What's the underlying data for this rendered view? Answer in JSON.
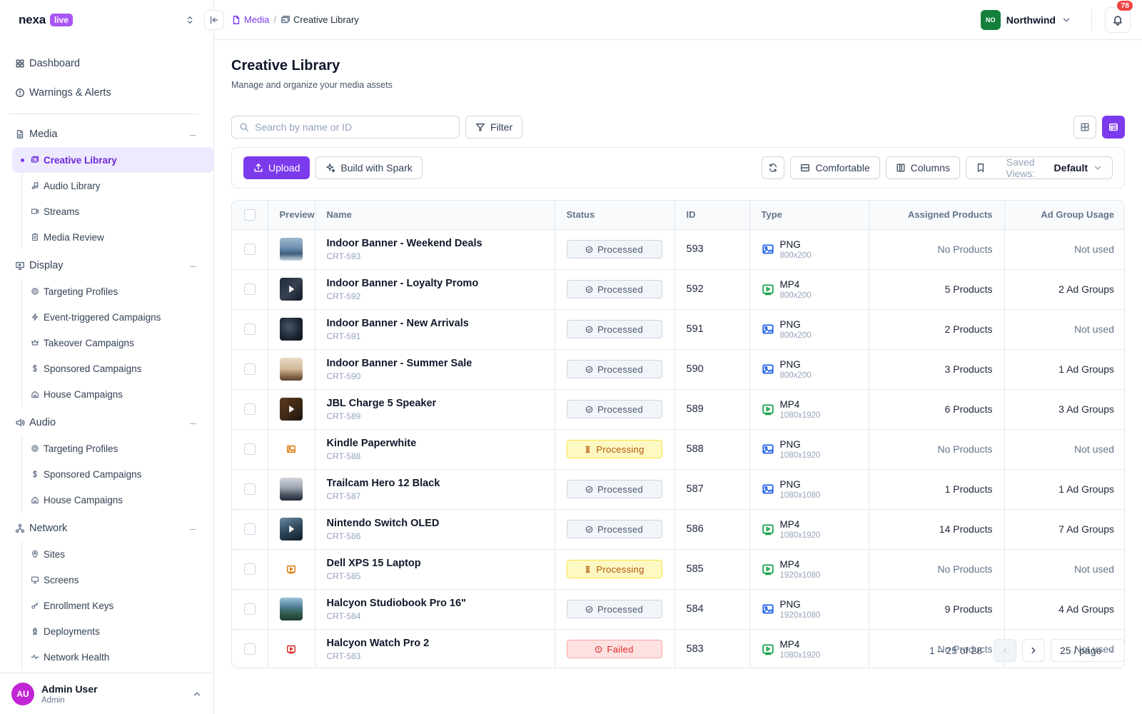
{
  "brand": {
    "name": "nexa",
    "badge": "live"
  },
  "sidebar": {
    "top": [
      {
        "label": "Dashboard",
        "icon": "dashboard-icon"
      },
      {
        "label": "Warnings & Alerts",
        "icon": "alert-icon"
      }
    ],
    "groups": [
      {
        "label": "Media",
        "icon": "document-icon",
        "items": [
          {
            "label": "Creative Library",
            "icon": "images-icon",
            "active": true
          },
          {
            "label": "Audio Library",
            "icon": "music-icon"
          },
          {
            "label": "Streams",
            "icon": "video-icon"
          },
          {
            "label": "Media Review",
            "icon": "clipboard-icon"
          }
        ]
      },
      {
        "label": "Display",
        "icon": "display-icon",
        "items": [
          {
            "label": "Targeting Profiles",
            "icon": "target-icon"
          },
          {
            "label": "Event-triggered Campaigns",
            "icon": "zap-icon"
          },
          {
            "label": "Takeover Campaigns",
            "icon": "crown-icon"
          },
          {
            "label": "Sponsored Campaigns",
            "icon": "dollar-icon"
          },
          {
            "label": "House Campaigns",
            "icon": "home-icon"
          }
        ]
      },
      {
        "label": "Audio",
        "icon": "speaker-icon",
        "items": [
          {
            "label": "Targeting Profiles",
            "icon": "target-icon"
          },
          {
            "label": "Sponsored Campaigns",
            "icon": "dollar-icon"
          },
          {
            "label": "House Campaigns",
            "icon": "home-icon"
          }
        ]
      },
      {
        "label": "Network",
        "icon": "network-icon",
        "items": [
          {
            "label": "Sites",
            "icon": "pin-icon"
          },
          {
            "label": "Screens",
            "icon": "monitor-icon"
          },
          {
            "label": "Enrollment Keys",
            "icon": "key-icon"
          },
          {
            "label": "Deployments",
            "icon": "rocket-icon"
          },
          {
            "label": "Network Health",
            "icon": "activity-icon"
          }
        ]
      }
    ],
    "user": {
      "initials": "AU",
      "name": "Admin User",
      "role": "Admin"
    }
  },
  "topbar": {
    "breadcrumb": [
      {
        "label": "Media"
      },
      {
        "label": "Creative Library"
      }
    ],
    "separator": "/",
    "org": {
      "initials": "NO",
      "name": "Northwind"
    },
    "notifications": "78"
  },
  "page": {
    "title": "Creative Library",
    "subtitle": "Manage and organize your media assets"
  },
  "search": {
    "placeholder": "Search by name or ID",
    "value": ""
  },
  "filter_label": "Filter",
  "toolbar": {
    "upload": "Upload",
    "spark": "Build with Spark",
    "density": "Comfortable",
    "columns": "Columns",
    "saved_views_label": "Saved Views:",
    "saved_views_value": "Default"
  },
  "table": {
    "headers": {
      "preview": "Preview",
      "name": "Name",
      "status": "Status",
      "id": "ID",
      "type": "Type",
      "products": "Assigned Products",
      "adgroups": "Ad Group Usage"
    },
    "rows": [
      {
        "name": "Indoor Banner - Weekend Deals",
        "cid": "CRT-593",
        "status": "Processed",
        "state": "processed",
        "id": "593",
        "type": "PNG",
        "dim": "800x200",
        "products": "No Products",
        "adgroups": "Not used",
        "thumb": "mountains"
      },
      {
        "name": "Indoor Banner - Loyalty Promo",
        "cid": "CRT-592",
        "status": "Processed",
        "state": "processed",
        "id": "592",
        "type": "MP4",
        "dim": "800x200",
        "products": "5 Products",
        "adgroups": "2 Ad Groups",
        "thumb": "video-dark"
      },
      {
        "name": "Indoor Banner - New Arrivals",
        "cid": "CRT-591",
        "status": "Processed",
        "state": "processed",
        "id": "591",
        "type": "PNG",
        "dim": "800x200",
        "products": "2 Products",
        "adgroups": "Not used",
        "thumb": "dark"
      },
      {
        "name": "Indoor Banner - Summer Sale",
        "cid": "CRT-590",
        "status": "Processed",
        "state": "processed",
        "id": "590",
        "type": "PNG",
        "dim": "800x200",
        "products": "3 Products",
        "adgroups": "1 Ad Groups",
        "thumb": "pier"
      },
      {
        "name": "JBL Charge 5 Speaker",
        "cid": "CRT-589",
        "status": "Processed",
        "state": "processed",
        "id": "589",
        "type": "MP4",
        "dim": "1080x1920",
        "products": "6 Products",
        "adgroups": "3 Ad Groups",
        "thumb": "video-brown"
      },
      {
        "name": "Kindle Paperwhite",
        "cid": "CRT-588",
        "status": "Processing",
        "state": "processing",
        "id": "588",
        "type": "PNG",
        "dim": "1080x1920",
        "products": "No Products",
        "adgroups": "Not used",
        "thumb": "ph-image"
      },
      {
        "name": "Trailcam Hero 12 Black",
        "cid": "CRT-587",
        "status": "Processed",
        "state": "processed",
        "id": "587",
        "type": "PNG",
        "dim": "1080x1080",
        "products": "1 Products",
        "adgroups": "1 Ad Groups",
        "thumb": "fog"
      },
      {
        "name": "Nintendo Switch OLED",
        "cid": "CRT-586",
        "status": "Processed",
        "state": "processed",
        "id": "586",
        "type": "MP4",
        "dim": "1080x1920",
        "products": "14 Products",
        "adgroups": "7 Ad Groups",
        "thumb": "video-lake"
      },
      {
        "name": "Dell XPS 15 Laptop",
        "cid": "CRT-585",
        "status": "Processing",
        "state": "processing",
        "id": "585",
        "type": "MP4",
        "dim": "1920x1080",
        "products": "No Products",
        "adgroups": "Not used",
        "thumb": "ph-video"
      },
      {
        "name": "Halcyon Studiobook Pro 16\"",
        "cid": "CRT-584",
        "status": "Processed",
        "state": "processed",
        "id": "584",
        "type": "PNG",
        "dim": "1920x1080",
        "products": "9 Products",
        "adgroups": "4 Ad Groups",
        "thumb": "coast"
      },
      {
        "name": "Halcyon Watch Pro 2",
        "cid": "CRT-583",
        "status": "Failed",
        "state": "failed",
        "id": "583",
        "type": "MP4",
        "dim": "1080x1920",
        "products": "No Products",
        "adgroups": "Not used",
        "thumb": "ph-video-red"
      }
    ]
  },
  "pagination": {
    "range": "1 – 25 of 28",
    "per_page": "25 / page"
  },
  "colors": {
    "accent": "#7c3aed",
    "processing": "#b45309",
    "failed": "#dc2626"
  }
}
